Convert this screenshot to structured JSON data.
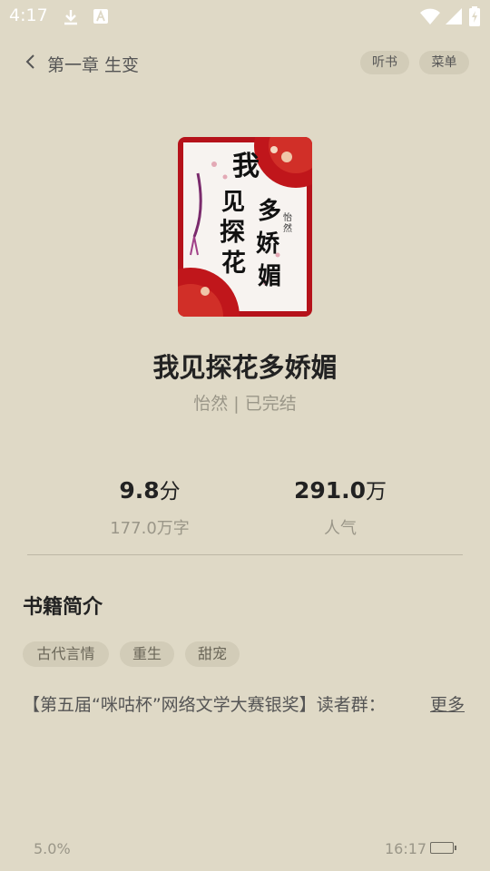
{
  "status_bar": {
    "time": "4:17",
    "icons": [
      "download-icon",
      "a-badge-icon",
      "wifi-icon",
      "signal-icon",
      "battery-charging-icon"
    ]
  },
  "header": {
    "chapter_title": "第一章 生变",
    "listen_label": "听书",
    "menu_label": "菜单"
  },
  "book": {
    "cover_text_main": "我见探花多娇媚",
    "cover_author_mark": "怡然",
    "title": "我见探花多娇媚",
    "meta": "怡然 | 已完结"
  },
  "stats": {
    "score_value": "9.8",
    "score_unit": "分",
    "words_label": "177.0万字",
    "popularity_value": "291.0",
    "popularity_unit": "万",
    "popularity_label": "人气"
  },
  "intro": {
    "section_title": "书籍简介",
    "tags": [
      "古代言情",
      "重生",
      "甜宠"
    ],
    "text": "【第五届“咪咕杯”网络文学大赛银奖】读者群：",
    "more_label": "更多"
  },
  "footer": {
    "progress": "5.0%",
    "clock": "16:17"
  },
  "colors": {
    "background": "#dfd9c6",
    "pill": "#d2ccb8",
    "cover_red": "#c0161b"
  }
}
